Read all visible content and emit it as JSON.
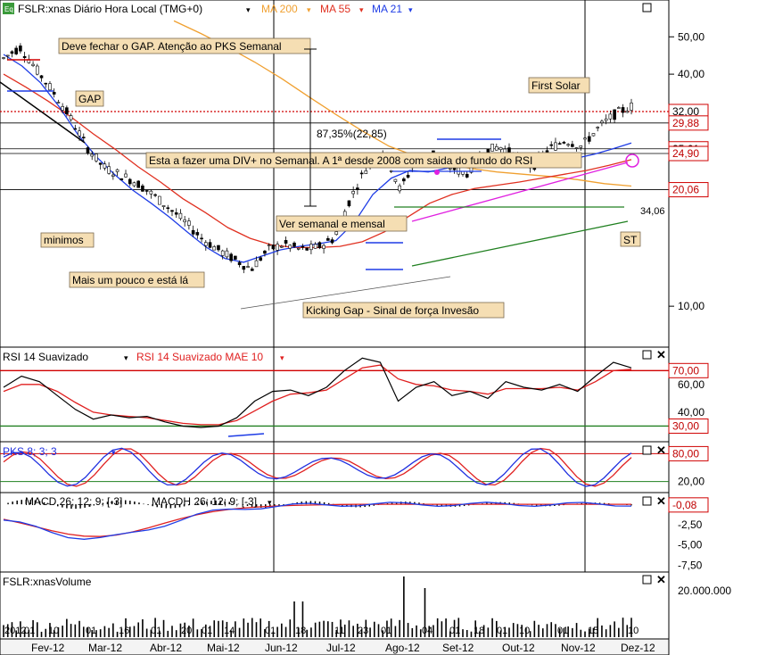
{
  "header": {
    "badge": "Eq",
    "symbol_label": "FSLR:xnas Diário Hora Local (TMG+0)",
    "ma200": "MA 200",
    "ma55": "MA 55",
    "ma21": "MA 21"
  },
  "panels": {
    "rsi": {
      "label_a": "RSI 14 Suavizado",
      "label_b": "RSI 14 Suavizado MAE 10"
    },
    "pks": {
      "label": "PKS 8; 3; 3"
    },
    "macd": {
      "label_a": "MACD 26; 12; 9; [-3]",
      "label_b": "MACDH 26; 12; 9; [-3]"
    },
    "volume": {
      "label": "FSLR:xnasVolume"
    }
  },
  "annotations": {
    "gap_warning": "Deve fechar o GAP. Atenção ao PKS Semanal",
    "gap": "GAP",
    "first_solar": "First Solar",
    "pct_move": "87,35%(22,85)",
    "div_plus": "Esta a fazer uma DIV+ no Semanal. A 1ª desde 2008 com saida do fundo do RSI",
    "minimos": "minimos",
    "ver_semanal": "Ver semanal e mensal",
    "mais_um_pouco": "Mais um pouco e está lá",
    "kicking_gap": "Kicking Gap - Sinal de força Invesão",
    "st": "ST",
    "level_34": "34,06"
  },
  "price_labels": [
    {
      "text": "32,00",
      "color": "#000000",
      "border": "#d00000",
      "price": 32.0
    },
    {
      "text": "29,88",
      "color": "#c00000",
      "border": "#d00000",
      "price": 29.88
    },
    {
      "text": "25,61",
      "color": "#000000",
      "border": "#d00000",
      "price": 25.61
    },
    {
      "text": "24,90",
      "color": "#c00000",
      "border": "#d00000",
      "price": 24.9
    },
    {
      "text": "20,06",
      "color": "#c00000",
      "border": "#d00000",
      "price": 20.06
    }
  ],
  "price_axis_ticks": [
    "50,00",
    "40,00",
    "10,00"
  ],
  "rsi_axis": {
    "ticks": [
      "60,00",
      "40,00"
    ],
    "boxes": [
      "70,00",
      "30,00"
    ]
  },
  "pks_axis": {
    "ticks": [
      "20,00"
    ],
    "boxes": [
      "80,00"
    ]
  },
  "macd_axis": {
    "ticks": [
      "-2,50",
      "-5,00",
      "-7,50"
    ],
    "boxes": [
      "-0,08"
    ]
  },
  "volume_axis": {
    "ticks": [
      "20.000.000"
    ]
  },
  "x_axis": {
    "days": [
      "2012",
      "01",
      "10",
      "01",
      "16",
      "01",
      "20",
      "01",
      "14",
      "01",
      "18",
      "11",
      "23",
      "01",
      "04",
      "01",
      "18",
      "01",
      "10",
      "01",
      "15",
      "10"
    ],
    "months": [
      "Fev-12",
      "Mar-12",
      "Abr-12",
      "Mai-12",
      "Jun-12",
      "Jul-12",
      "Ago-12",
      "Set-12",
      "Out-12",
      "Nov-12",
      "Dez-12"
    ]
  },
  "colors": {
    "ma200": "#f0a030",
    "ma55": "#e03020",
    "ma21": "#1e3ce6",
    "rsi": "#000000",
    "rsi_signal": "#e02020",
    "pks_k": "#2030e0",
    "pks_d": "#e02020",
    "trend_magenta": "#e020e0",
    "trend_green": "#208020"
  },
  "chart_data": {
    "type": "candlestick",
    "title": "FSLR:xnas Diário Hora Local (TMG+0)",
    "xlabel": "",
    "ylabel": "",
    "ylim": [
      8,
      56
    ],
    "log_scale": true,
    "series": [
      {
        "name": "FSLR:xnas",
        "close": [
          44,
          47,
          41,
          36,
          31,
          26,
          23,
          22,
          21,
          19.5,
          18,
          16.5,
          15,
          14,
          13.2,
          12.5,
          14,
          14.5,
          14,
          14.2,
          15,
          19,
          23,
          25.5,
          20,
          24,
          25,
          23,
          22,
          25,
          26,
          24.5,
          23,
          25.5,
          27,
          26,
          29,
          31.5,
          33
        ]
      },
      {
        "name": "MA 21",
        "values": [
          45,
          42,
          38,
          33,
          28,
          24.5,
          22,
          20,
          18.5,
          17,
          15.5,
          14.2,
          13.3,
          13,
          13.5,
          14,
          14.3,
          14.5,
          14.8,
          16.5,
          19.5,
          21.5,
          22.5,
          22.3,
          22.8,
          23.5,
          23.3,
          23.2,
          24,
          24.4,
          24.5,
          24.2,
          24.8,
          25.6,
          26.5
        ]
      },
      {
        "name": "MA 55",
        "values": [
          40,
          37,
          34,
          31,
          28,
          25.5,
          23,
          21,
          19,
          17.5,
          16,
          15,
          14.4,
          14.2,
          14.2,
          14.3,
          14.7,
          15.6,
          17,
          18.5,
          19.5,
          20.2,
          20.6,
          21,
          21.5,
          22,
          22.5,
          23.2,
          24
        ]
      },
      {
        "name": "MA 200",
        "values": [
          55,
          51,
          47,
          43,
          39,
          35,
          31.5,
          28.5,
          26,
          24.5,
          23.5,
          22.8,
          22.3,
          22,
          21.7,
          21.3,
          20.8,
          20.5
        ]
      },
      {
        "name": "RSI 14 Suavizado",
        "values": [
          58,
          66,
          62,
          52,
          42,
          35,
          38,
          36,
          37,
          33,
          30,
          29,
          30,
          36,
          48,
          55,
          56,
          52,
          58,
          70,
          79,
          76,
          48,
          58,
          62,
          52,
          55,
          50,
          62,
          58,
          56,
          60,
          55,
          66,
          76,
          72
        ]
      },
      {
        "name": "RSI 14 Suavizado MAE 10",
        "values": [
          55,
          60,
          60,
          55,
          47,
          40,
          38,
          37,
          36,
          34,
          32,
          31,
          31,
          34,
          41,
          48,
          53,
          54,
          56,
          64,
          72,
          74,
          64,
          60,
          59,
          56,
          55,
          53,
          57,
          57,
          57,
          58,
          56,
          62,
          70,
          71
        ]
      }
    ],
    "horizontal_levels": [
      32.0,
      29.88,
      25.61,
      24.9,
      20.06
    ],
    "rsi_levels": [
      70,
      30
    ],
    "macd_last": -0.08
  }
}
